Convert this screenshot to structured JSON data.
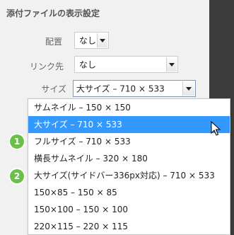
{
  "panel": {
    "title": "添付ファイルの表示設定",
    "align": {
      "label": "配置",
      "value": "なし"
    },
    "link": {
      "label": "リンク先",
      "value": "なし"
    },
    "size": {
      "label": "サイズ",
      "value": "大サイズ – 710 × 533"
    }
  },
  "dropdown": {
    "options": [
      "サムネイル – 150 × 150",
      "大サイズ – 710 × 533",
      "フルサイズ – 710 × 533",
      "横長サムネイル – 320 × 180",
      "大サイズ(サイドバー336px対応) – 710 × 533",
      "150×85 – 150 × 85",
      "150×100 – 150 × 100",
      "220×115 – 220 × 115"
    ],
    "highlighted_index": 1
  },
  "annotations": {
    "badge1": "1",
    "badge2": "2"
  },
  "colors": {
    "highlight": "#3399ff",
    "badge": "#6cc04a"
  }
}
